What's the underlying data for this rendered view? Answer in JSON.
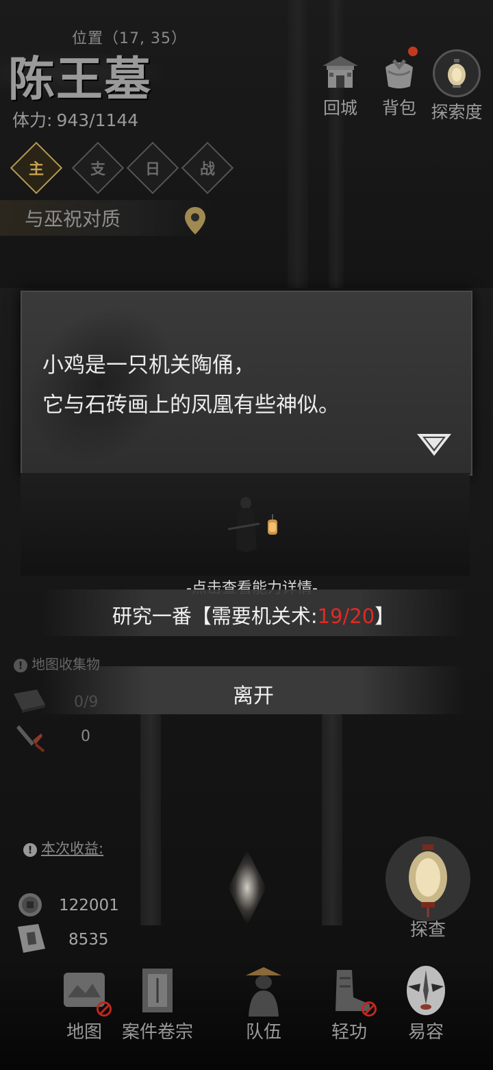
{
  "header": {
    "position_label": "位置（17, 35）",
    "location_title": "陈王墓",
    "stamina_label": "体力:",
    "stamina_value": "943/1144"
  },
  "top_buttons": [
    {
      "label": "回城",
      "icon": "city-gate-icon"
    },
    {
      "label": "背包",
      "icon": "bundle-icon",
      "has_notification": true
    },
    {
      "label": "探索度",
      "icon": "lantern-icon"
    }
  ],
  "tabs": [
    {
      "label": "主",
      "active": true
    },
    {
      "label": "支",
      "active": false
    },
    {
      "label": "日",
      "active": false
    },
    {
      "label": "战",
      "active": false
    }
  ],
  "quest": {
    "label": "与巫祝对质",
    "icon": "map-pin-icon"
  },
  "dialog": {
    "line1": "小鸡是一只机关陶俑，",
    "line2": "它与石砖画上的凤凰有些神似。"
  },
  "choices": {
    "hint": "-点击查看能力详情-",
    "research_prefix": "研究一番【需要机关术:",
    "research_requirement": "19/20",
    "research_suffix": "】",
    "leave": "离开"
  },
  "collection": {
    "header": "地图收集物",
    "items": [
      {
        "icon": "book-icon",
        "value": "0/9"
      },
      {
        "icon": "dagger-icon",
        "value": "0"
      }
    ]
  },
  "earnings": {
    "header": "本次收益:",
    "coins": "122001",
    "exp": "8535"
  },
  "investigate": {
    "label": "探查"
  },
  "bottom_nav": [
    {
      "label": "地图",
      "icon": "scroll-map-icon",
      "disabled": true
    },
    {
      "label": "案件卷宗",
      "icon": "case-file-icon",
      "disabled": false
    },
    {
      "label": "队伍",
      "icon": "team-icon",
      "disabled": false
    },
    {
      "label": "轻功",
      "icon": "boots-icon",
      "disabled": true
    },
    {
      "label": "易容",
      "icon": "opera-mask-icon",
      "disabled": false
    }
  ],
  "colors": {
    "accent_gold": "#c9a24f",
    "warning_red": "#e02a24"
  }
}
